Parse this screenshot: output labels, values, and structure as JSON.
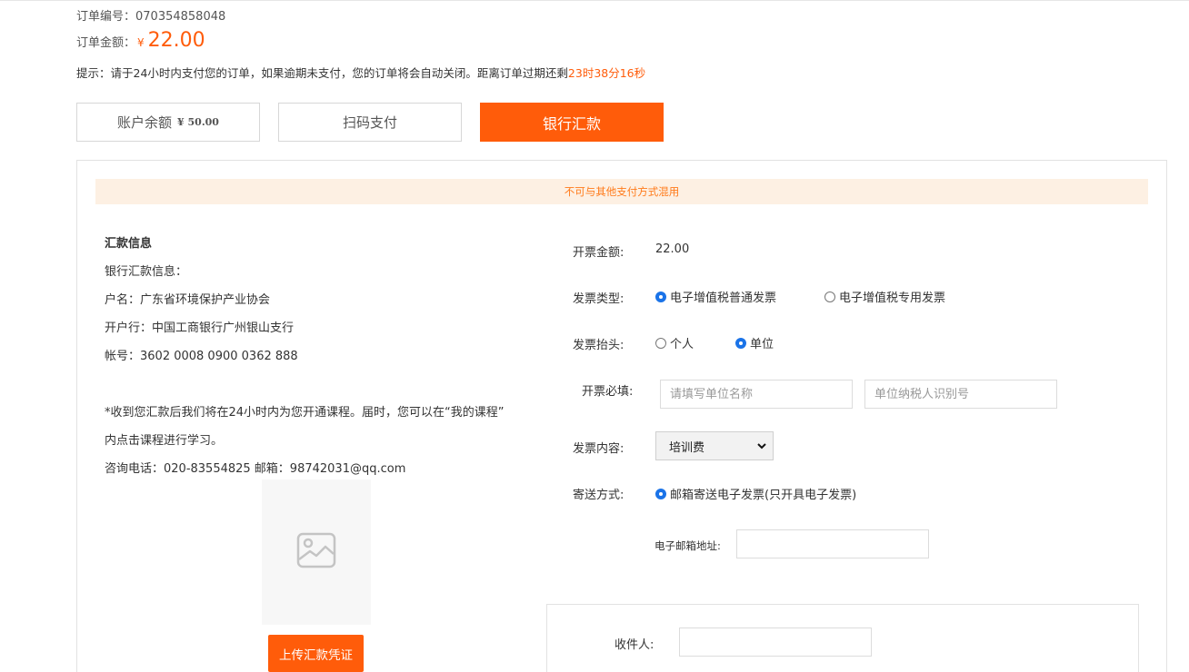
{
  "order": {
    "number_label": "订单编号：",
    "number": "070354858048",
    "amount_label": "订单金额：",
    "currency": "¥",
    "amount": "22.00",
    "tip_text": "提示：请于24小时内支付您的订单，如果逾期未支付，您的订单将会自动关闭。距离订单过期还剩",
    "countdown": "23时38分16秒"
  },
  "pay_tabs": {
    "balance_label": "账户余额",
    "balance_value": "¥ 50.00",
    "qr_label": "扫码支付",
    "bank_label": "银行汇款",
    "active": "bank"
  },
  "notice": "不可与其他支付方式混用",
  "remit": {
    "title": "汇款信息",
    "lines": [
      "银行汇款信息：",
      "户名：广东省环境保护产业协会",
      "开户行：中国工商银行广州银山支行",
      "帐号：3602 0008 0900 0362 888"
    ],
    "note1": "*收到您汇款后我们将在24小时内为您开通课程。届时，您可以在“我的课程”",
    "note2": "内点击课程进行学习。",
    "contact": "咨询电话：020-83554825 邮箱：98742031@qq.com",
    "upload_label": "上传汇款凭证"
  },
  "invoice": {
    "amount_label": "开票金额:",
    "amount_value": "22.00",
    "type_label": "发票类型:",
    "type_options": [
      "电子增值税普通发票",
      "电子增值税专用发票"
    ],
    "type_selected": 0,
    "title_label": "发票抬头:",
    "title_options": [
      "个人",
      "单位"
    ],
    "title_selected": 1,
    "required_label": "开票必填:",
    "company_placeholder": "请填写单位名称",
    "taxid_placeholder": "单位纳税人识别号",
    "content_label": "发票内容:",
    "content_value": "培训费",
    "delivery_label": "寄送方式:",
    "delivery_option": "邮箱寄送电子发票(只开具电子发票)",
    "email_label": "电子邮箱地址:",
    "email_value": "",
    "receiver_label": "收件人:",
    "receiver_value": ""
  },
  "colors": {
    "accent": "#ff5c0a",
    "notice_bg": "#fdf0e3",
    "notice_text": "#ff7a1a",
    "radio_on": "#1a73e8"
  }
}
